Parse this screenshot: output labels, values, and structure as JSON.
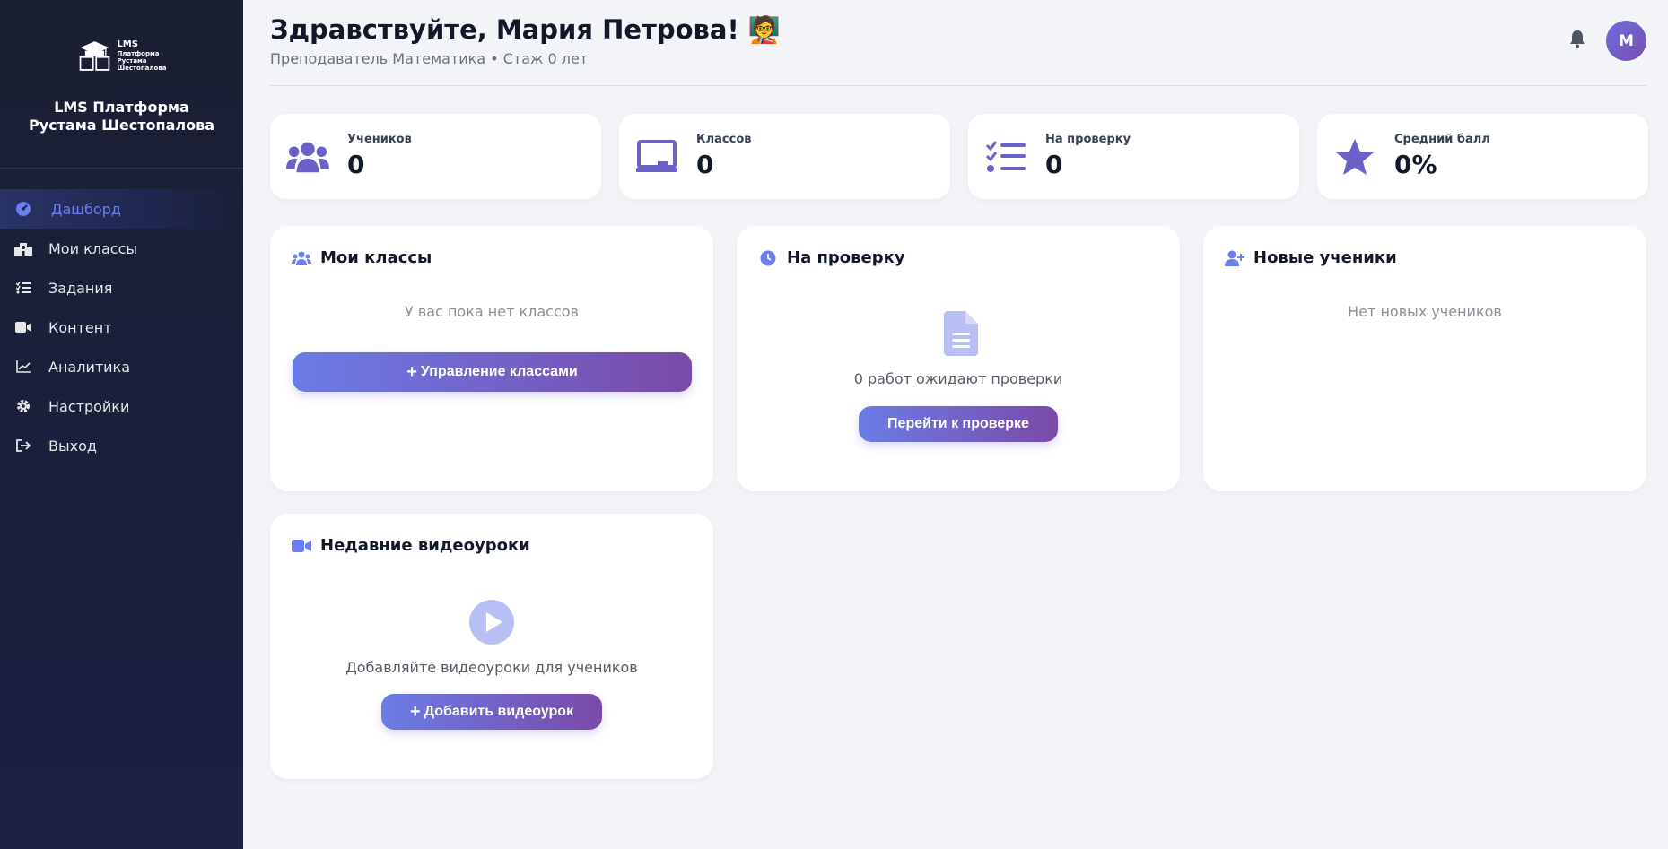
{
  "sidebar": {
    "logo_lines": [
      "LMS",
      "Платформа",
      "Рустама",
      "Шестопалова"
    ],
    "brand_line1": "LMS Платформа",
    "brand_line2": "Рустама Шестопалова",
    "items": [
      {
        "label": "Дашборд",
        "icon": "dashboard-icon",
        "active": true
      },
      {
        "label": "Мои классы",
        "icon": "school-icon"
      },
      {
        "label": "Задания",
        "icon": "tasks-icon"
      },
      {
        "label": "Контент",
        "icon": "video-icon"
      },
      {
        "label": "Аналитика",
        "icon": "chart-icon"
      },
      {
        "label": "Настройки",
        "icon": "gear-icon"
      },
      {
        "label": "Выход",
        "icon": "logout-icon"
      }
    ]
  },
  "header": {
    "greeting": "Здравствуйте, Мария Петрова! 🧑‍🏫",
    "subtitle": "Преподаватель Математика • Стаж 0 лет",
    "avatar_letter": "М"
  },
  "stats": [
    {
      "label": "Учеников",
      "value": "0",
      "icon": "users-icon"
    },
    {
      "label": "Классов",
      "value": "0",
      "icon": "chalkboard-icon"
    },
    {
      "label": "На проверку",
      "value": "0",
      "icon": "checklist-icon"
    },
    {
      "label": "Средний балл",
      "value": "0%",
      "icon": "star-icon"
    }
  ],
  "cards": {
    "classes": {
      "title": "Мои классы",
      "empty": "У вас пока нет классов",
      "button": "Управление классами"
    },
    "review": {
      "title": "На проверку",
      "text": "0 работ ожидают проверки",
      "button": "Перейти к проверке"
    },
    "students": {
      "title": "Новые ученики",
      "empty": "Нет новых учеников"
    },
    "videos": {
      "title": "Недавние видеоуроки",
      "text": "Добавляйте видеоуроки для учеников",
      "button": "Добавить видеоурок"
    }
  },
  "colors": {
    "accent": "#6b7ff0",
    "sidebar_bg": "#1a1f33",
    "icon": "#6a62c9"
  }
}
